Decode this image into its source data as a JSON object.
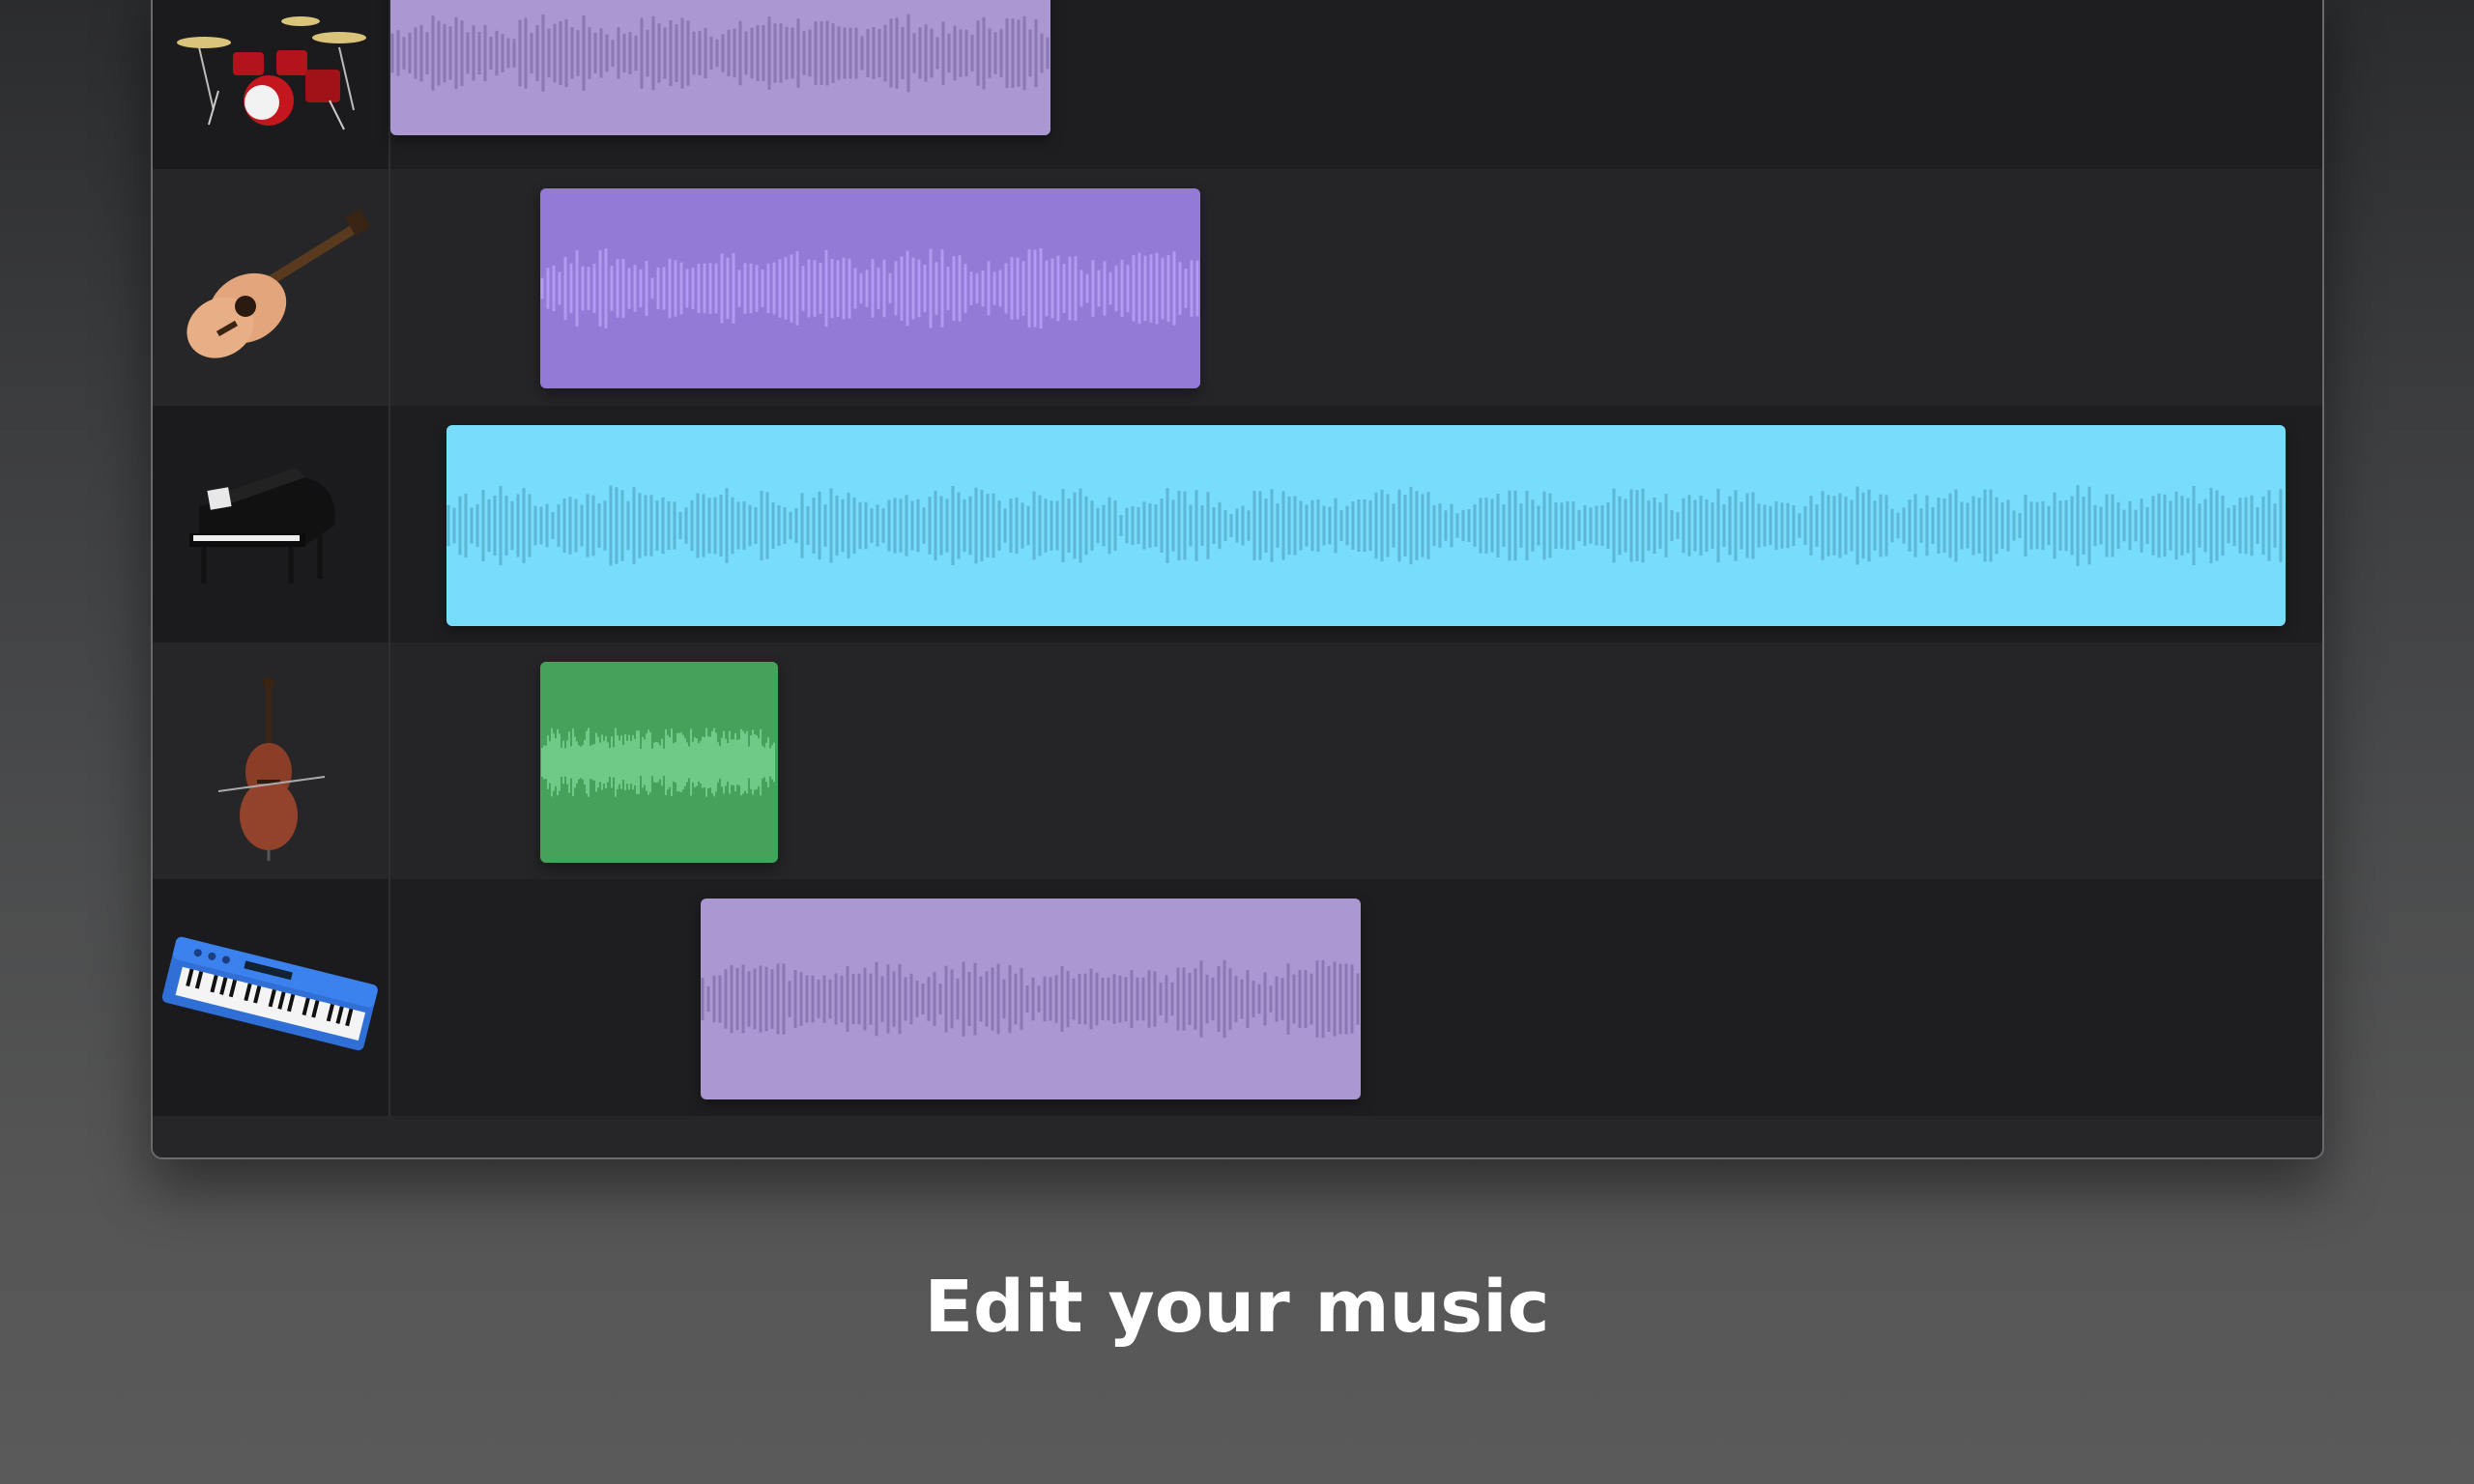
{
  "caption": "Edit your music",
  "tracks": [
    {
      "instrument": "drum-kit-icon",
      "region_color": "#ab97d2",
      "wave_color": "#8a78b4",
      "wave_style": "bars"
    },
    {
      "instrument": "acoustic-guitar-icon",
      "region_color": "#927ad6",
      "wave_color": "#b29af0",
      "wave_style": "bars"
    },
    {
      "instrument": "grand-piano-icon",
      "region_color": "#78dcfc",
      "wave_color": "#5cb6d4",
      "wave_style": "bars"
    },
    {
      "instrument": "cello-icon",
      "region_color": "#45a25b",
      "wave_color": "#6fc987",
      "wave_style": "dense"
    },
    {
      "instrument": "synth-keyboard-icon",
      "region_color": "#ab97d2",
      "wave_color": "#8a78b4",
      "wave_style": "bars"
    }
  ],
  "colors": {
    "window_bg": "#1f1f21",
    "caption_text": "#ffffff"
  }
}
